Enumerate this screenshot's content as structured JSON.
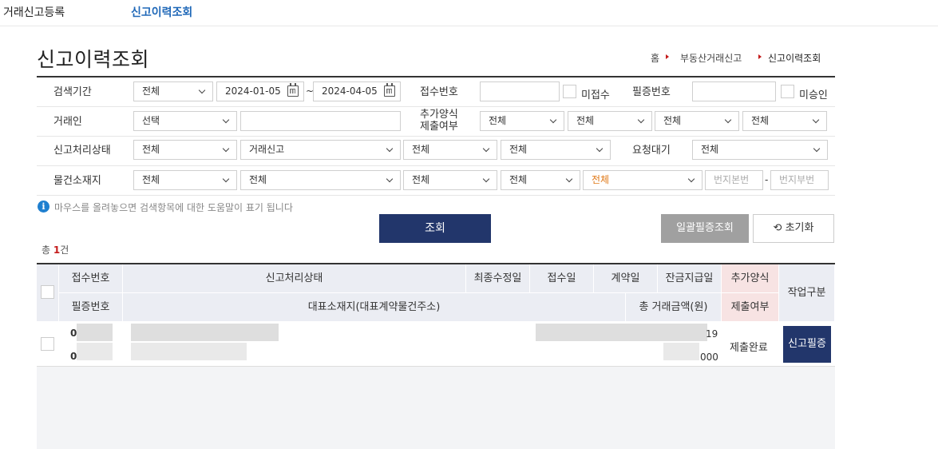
{
  "topnav": {
    "item1": "거래신고등록",
    "item2": "신고이력조회"
  },
  "page_title": "신고이력조회",
  "breadcrumb": {
    "home": "홈",
    "level1": "부동산거래신고",
    "level2": "신고이력조회"
  },
  "form": {
    "period_label": "검색기간",
    "period_select": "전체",
    "date_from": "2024-01-05",
    "date_sep": "~",
    "date_to": "2024-04-05",
    "receipt_no_label": "접수번호",
    "unreceived_label": "미접수",
    "cert_no_label": "필증번호",
    "unapproved_label": "미승인",
    "party_label": "거래인",
    "party_select": "선택",
    "add_form_label_1": "추가양식",
    "add_form_label_2": "제출여부",
    "add_selects": [
      "전체",
      "전체",
      "전체",
      "전체"
    ],
    "status_label": "신고처리상태",
    "status_select1": "전체",
    "status_select2": "거래신고",
    "status_select3": "전체",
    "status_select4": "전체",
    "request_wait_label": "요청대기",
    "request_wait_select": "전체",
    "location_label": "물건소재지",
    "location_selects": [
      "전체",
      "전체",
      "전체",
      "전체",
      "전체"
    ],
    "lot_main_placeholder": "번지본번",
    "lot_dash": "-",
    "lot_sub_placeholder": "번지부번"
  },
  "info_text": "마우스를 올려놓으면 검색항목에 대한 도움말이 표기 됩니다",
  "buttons": {
    "search": "조회",
    "bulk_cert": "일괄필증조회",
    "reset": "초기화"
  },
  "count": {
    "prefix": "총 ",
    "value": "1",
    "suffix": "건"
  },
  "table": {
    "headers_row1": [
      "접수번호",
      "신고처리상태",
      "최종수정일",
      "접수일",
      "계약일",
      "잔금지급일",
      "추가양식"
    ],
    "headers_row2": [
      "필증번호",
      "대표소재지(대표계약물건주소)",
      "총 거래금액(원)",
      "제출여부"
    ],
    "work_header": "작업구분",
    "row": {
      "receipt_no_visible": "0",
      "cert_no_visible": "0",
      "balance_date_tail": "19",
      "amount_tail": "000",
      "submission": "제출완료",
      "action": "신고필증"
    }
  },
  "colors": {
    "navy": "#22366b",
    "link_blue": "#1f68b8",
    "gray_button": "#a0a0a0",
    "accent_red": "#c41b1b"
  }
}
